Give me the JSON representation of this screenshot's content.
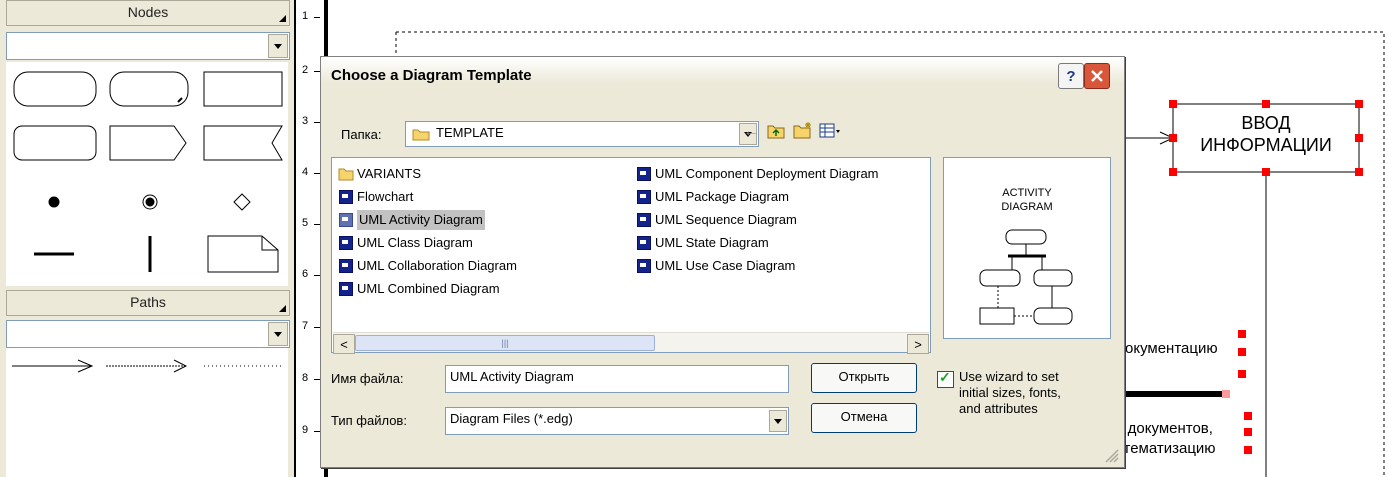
{
  "palette": {
    "nodes_title": "Nodes",
    "paths_title": "Paths"
  },
  "ruler": {
    "marks": [
      "1",
      "2",
      "3",
      "4",
      "5",
      "6",
      "7",
      "8",
      "9"
    ]
  },
  "canvas": {
    "node_text_line1": "ВВОД",
    "node_text_line2": "ИНФОРМАЦИИ",
    "text_doc1": "окументацию",
    "text_doc2": "х документов,",
    "text_doc3": "стематизацию"
  },
  "dialog": {
    "title": "Choose a Diagram Template",
    "help_label": "?",
    "folder_label": "Папка:",
    "folder_value": "TEMPLATE",
    "file_items_col1": [
      "VARIANTS",
      "Flowchart",
      "UML Activity Diagram",
      "UML Class Diagram",
      "UML Collaboration Diagram",
      "UML Combined Diagram"
    ],
    "file_items_col2": [
      "UML Component Deployment Diagram",
      "UML Package Diagram",
      "UML Sequence Diagram",
      "UML State Diagram",
      "UML Use Case Diagram"
    ],
    "selected_item": "UML Activity Diagram",
    "preview_line1": "ACTIVITY",
    "preview_line2": "DIAGRAM",
    "filename_label": "Имя файла:",
    "filename_value": "UML Activity Diagram",
    "filetype_label": "Тип файлов:",
    "filetype_value": "Diagram Files (*.edg)",
    "open_button": "Открыть",
    "cancel_button": "Отмена",
    "wizard_line1": "Use wizard to set",
    "wizard_line2": "initial sizes, fonts,",
    "wizard_line3": "and attributes",
    "wizard_checked": true
  },
  "colors": {
    "selection_handle": "#ff0000",
    "dialog_bg": "#ece9d8",
    "close_red": "#d8563a"
  }
}
